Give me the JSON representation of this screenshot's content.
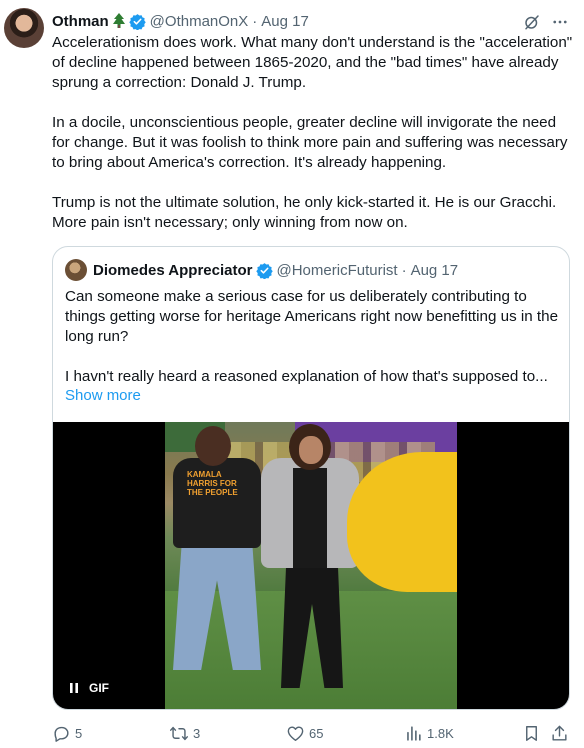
{
  "tweet": {
    "author": {
      "name": "Othman",
      "name_emoji": "🌲",
      "handle": "@OthmanOnX",
      "date": "Aug 17",
      "verified": true
    },
    "paragraphs": [
      "Accelerationism does work. What many don't understand is the \"acceleration\" of decline happened between 1865-2020, and the \"bad times\" have already sprung a correction: Donald J. Trump.",
      "In a docile, unconscientious people, greater decline will invigorate the need for change. But it was foolish to think more pain and suffering was necessary to bring about America's correction. It's already happening.",
      "Trump is not the ultimate solution, he only kick-started it. He is our Gracchi. More pain isn't necessary; only winning from now on."
    ],
    "icons": {
      "grok": "grok-icon",
      "more": "more-dots-icon"
    }
  },
  "quote": {
    "author": {
      "name": "Diomedes Appreciator",
      "handle": "@HomericFuturist",
      "date": "Aug 17",
      "verified": true
    },
    "paragraphs": [
      "Can someone make a serious case for us deliberately contributing to things getting worse for heritage Americans right now benefitting us in the long run?",
      "I havn't really heard a reasoned explanation of how that's supposed to..."
    ],
    "show_more": "Show more",
    "media": {
      "badge": "GIF",
      "shirt_text_1": "KAMALA",
      "shirt_text_2": "HARRIS FOR",
      "shirt_text_3": "THE PEOPLE"
    }
  },
  "actions": {
    "replies": "5",
    "reposts": "3",
    "likes": "65",
    "views": "1.8K"
  },
  "colors": {
    "text": "#0f1419",
    "secondary": "#536471",
    "link": "#1d9bf0",
    "verified": "#1d9bf0",
    "border": "#cfd9de"
  }
}
